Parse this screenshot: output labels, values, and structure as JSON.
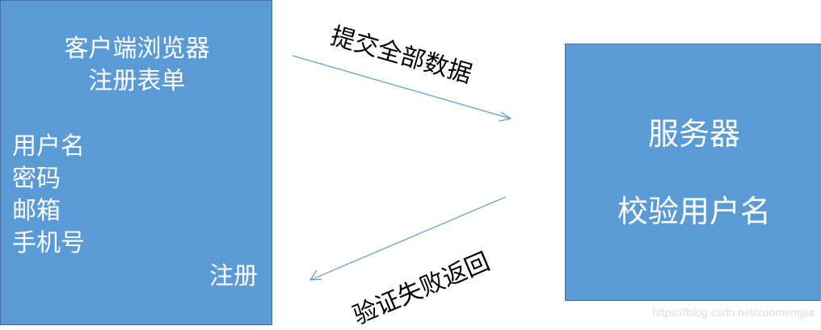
{
  "client": {
    "title_line1": "客户端浏览器",
    "title_line2": "注册表单",
    "fields": [
      "用户名",
      "密码",
      "邮箱",
      "手机号"
    ],
    "submit_label": "注册"
  },
  "server": {
    "title": "服务器",
    "action": "校验用户名"
  },
  "arrows": {
    "request_label": "提交全部数据",
    "response_label": "验证失败返回"
  },
  "watermark": "https://blog.csdn.net/zuomengjia",
  "colors": {
    "box_fill": "#5b9bd5",
    "box_border": "#41719c",
    "arrow": "#5b9bd5"
  }
}
